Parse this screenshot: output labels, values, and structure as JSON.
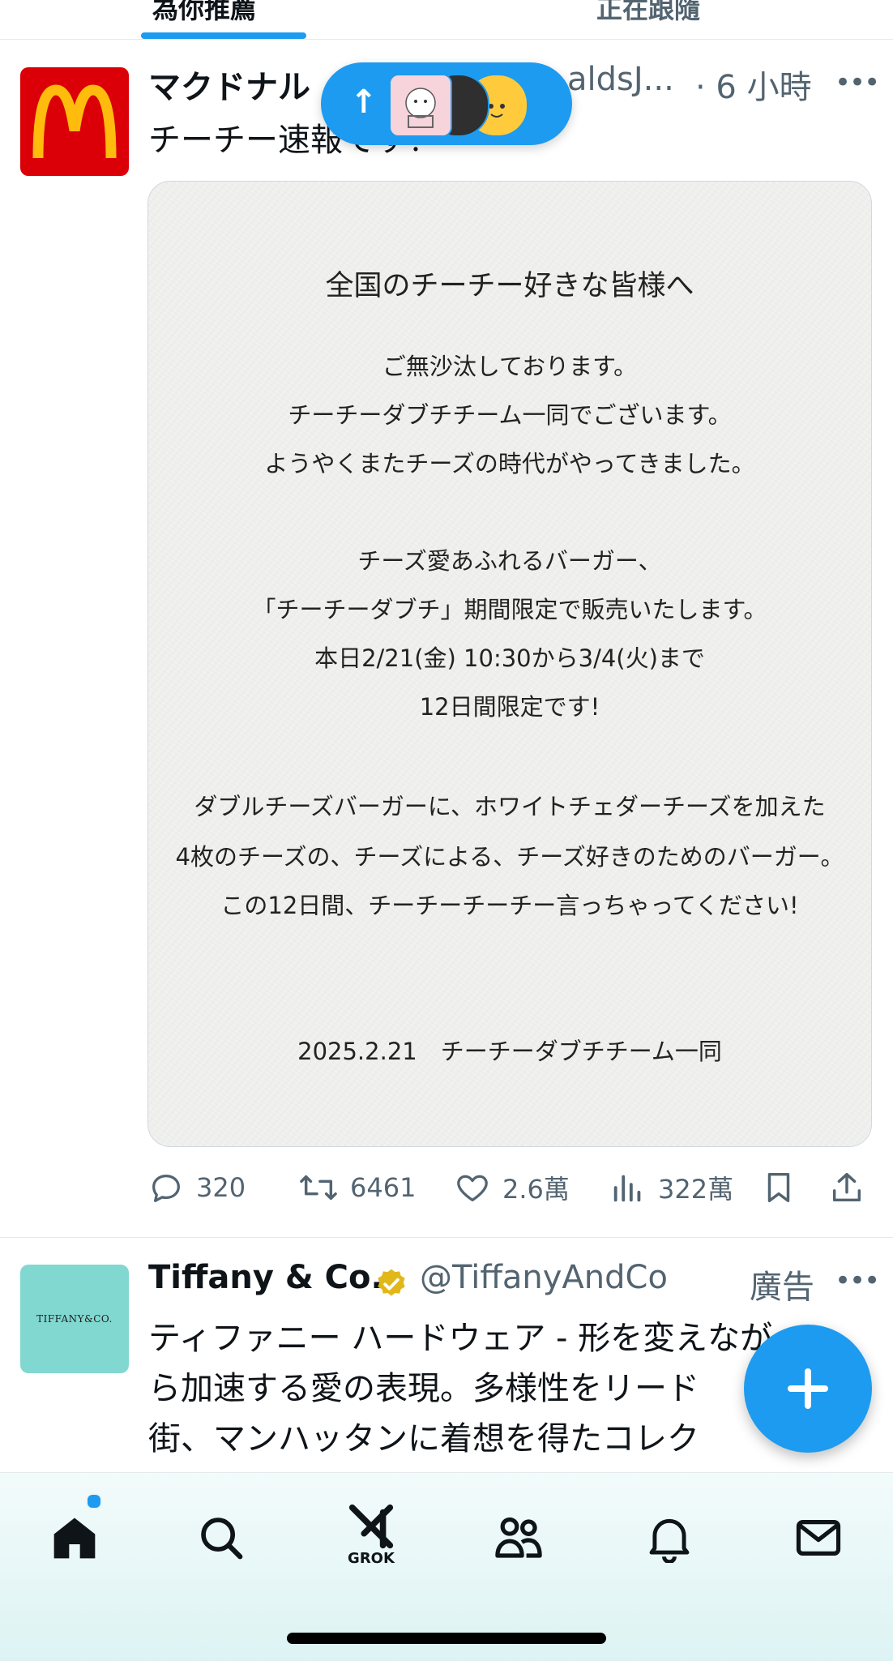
{
  "top_tabs": [
    {
      "label": "為你推薦"
    },
    {
      "label": "正在跟隨"
    }
  ],
  "tweet1": {
    "name": "マクドナル",
    "handle": "aldsJ...",
    "time": "· 6 小時",
    "text": "チーチー速報です！",
    "image_text": {
      "title": "全国のチーチー好きな皆様へ",
      "p1": [
        "ご無沙汰しております。",
        "チーチーダブチチーム一同でございます。",
        "ようやくまたチーズの時代がやってきました。"
      ],
      "p2": [
        "チーズ愛あふれるバーガー、",
        "「チーチーダブチ」期間限定で販売いたします。",
        "本日2/21(金) 10:30から3/4(火)まで",
        "12日間限定です!"
      ],
      "p3": [
        "ダブルチーズバーガーに、ホワイトチェダーチーズを加えた",
        "4枚のチーズの、チーズによる、チーズ好きのためのバーガー。",
        "この12日間、チーチーチーチー言っちゃってください!"
      ],
      "signature": "2025.2.21　チーチーダブチチーム一同"
    },
    "stats": {
      "replies": "320",
      "retweets": "6461",
      "likes": "2.6萬",
      "views": "322萬"
    }
  },
  "tweet2": {
    "name": "Tiffany & Co.",
    "handle": "@TiffanyAndCo",
    "ad_label": "廣告",
    "avatar_text": "TIFFANY&CO.",
    "text_lines": [
      "ティファニー ハードウェア - 形を変えなが",
      "ら加速する愛の表現。多様性をリード",
      "街、マンハッタンに着想を得たコレク"
    ]
  },
  "pill": {
    "arrow": "↑"
  },
  "nav": {
    "grok_label": "GROK"
  },
  "colors": {
    "accent": "#1d9bf0",
    "mcd_red": "#db0007",
    "mcd_gold": "#ffbc0d",
    "tiffany_blue": "#81d8d0"
  }
}
